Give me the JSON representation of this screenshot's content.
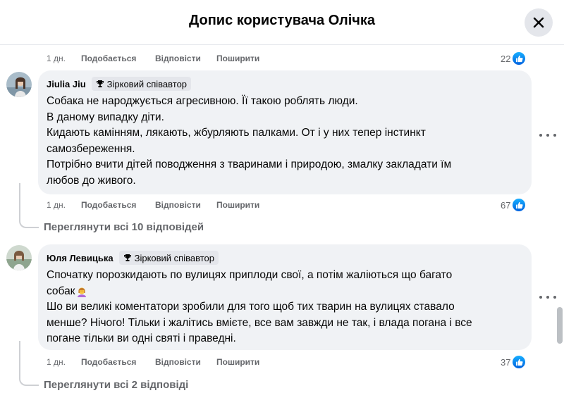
{
  "header": {
    "title": "Допис користувача Олічка"
  },
  "actions": {
    "like": "Подобається",
    "reply": "Відповісти",
    "share": "Поширити"
  },
  "top_row": {
    "time": "1 дн.",
    "reactions": "22"
  },
  "comments": [
    {
      "author": "Jiulia Jiu",
      "badge": "Зірковий співавтор",
      "lines": [
        "Собака не народжується агресивною. Її такою роблять люди.",
        "В даному випадку діти.",
        "Кидають камінням, лякають, жбурляють палками. От і у них тепер інстинкт",
        "самозбереження.",
        "Потрібно вчити дітей поводження з тваринами і природою, змалку закладати їм",
        "любов до живого."
      ],
      "time": "1 дн.",
      "reactions": "67",
      "view_replies": "Переглянути всі 10 відповідей"
    },
    {
      "author": "Юля Левицька",
      "badge": "Зірковий співавтор",
      "lines": [
        "Спочатку порозкидають по вулицях приплоди свої, а потім жаліються що багато",
        "собак",
        "Шо ви великі коментатори зробили для того щоб тих тварин на вулицях ставало",
        "менше? Нічого! Тільки і жалітись вмієте, все вам завжди не так, і влада погана і все",
        "погане тільки ви одні святі і праведні."
      ],
      "emoji": "person-facepalming",
      "time": "1 дн.",
      "reactions": "37",
      "view_replies": "Переглянути всі 2 відповіді"
    }
  ],
  "colors": {
    "like_blue": "#0866ff",
    "bubble": "#f0f2f5",
    "secondary_text": "#65676b"
  }
}
